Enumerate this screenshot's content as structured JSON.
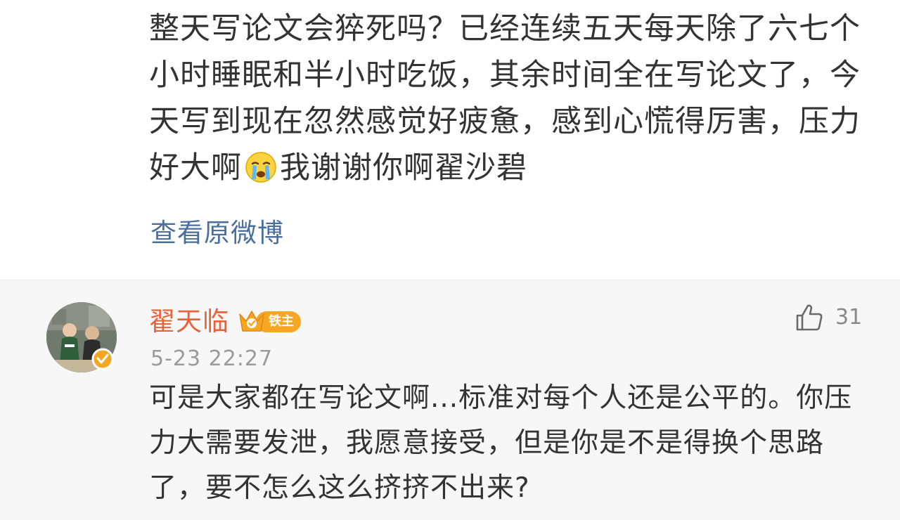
{
  "quoted_post": {
    "text_part1": "整天写论文会猝死吗？已经连续五天每天除了六七个小时睡眠和半小时吃饭，其余时间全在写论文了，今天写到现在忽然感觉好疲惫，感到心慌得厉害，压力好大啊",
    "emoji_icon": "crying-face-icon",
    "text_part2": "我谢谢你啊翟沙碧",
    "view_original_label": "查看原微博"
  },
  "reply": {
    "username": "翟天临",
    "fan_badge_label": "铁主",
    "timestamp": "5-23 22:27",
    "like_count": "31",
    "text": "可是大家都在写论文啊...标准对每个人还是公平的。你压力大需要发泄，我愿意接受，但是你是不是得换个思路了，要不怎么这么挤挤不出来?"
  },
  "colors": {
    "username": "#e8623a",
    "link": "#4a6f9c",
    "timestamp": "#9a9a9a",
    "badge": "#f6a623",
    "text": "#333333"
  }
}
